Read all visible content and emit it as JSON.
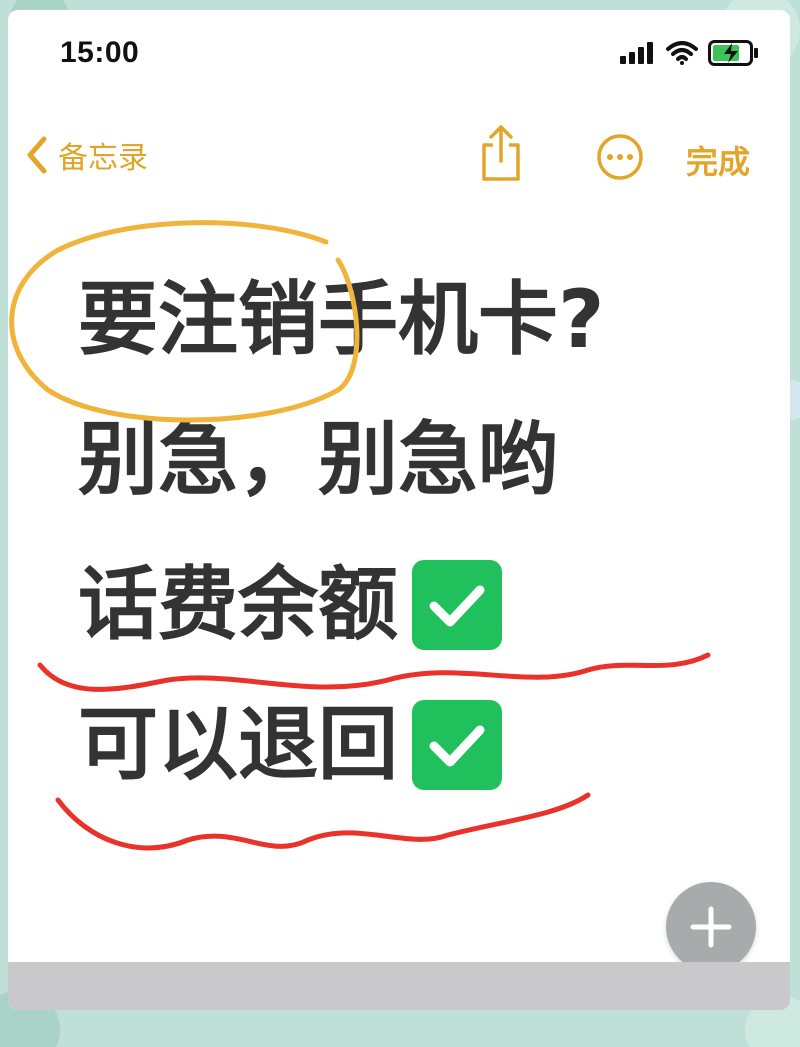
{
  "status": {
    "time": "15:00"
  },
  "nav": {
    "back_label": "备忘录",
    "done_label": "完成"
  },
  "note": {
    "lines": [
      "要注销手机卡?",
      "别急，别急哟",
      "话费余额",
      "可以退回"
    ]
  },
  "icons": {
    "back": "chevron-left-icon",
    "share": "share-icon",
    "more": "ellipsis-circle-icon",
    "check": "check-mark-icon",
    "add": "plus-icon"
  },
  "colors": {
    "accent": "#e2a52a",
    "text": "#333333",
    "check": "#20c05c",
    "annotation_yellow": "#f0b43a",
    "annotation_red": "#e8322a"
  }
}
